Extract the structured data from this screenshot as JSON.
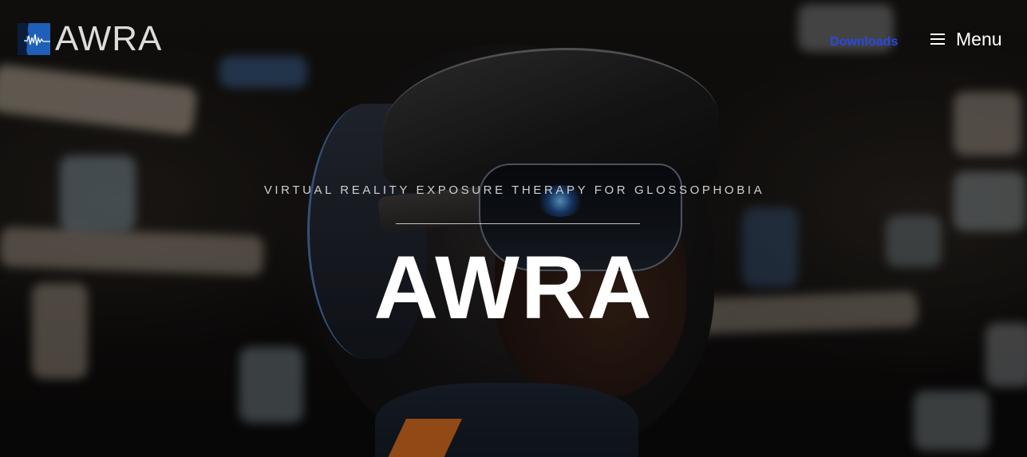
{
  "header": {
    "logo_text": "AWRA",
    "logo_icon": "sound-wave-head-icon",
    "nav": {
      "downloads_label": "Downloads",
      "menu_label": "Menu",
      "menu_icon": "hamburger-icon"
    },
    "colors": {
      "downloads_link": "#2a48e0",
      "logo_mark": "#1f5fb8"
    }
  },
  "hero": {
    "tagline": "VIRTUAL REALITY EXPOSURE THERAPY FOR GLOSSOPHOBIA",
    "title": "AWRA"
  }
}
